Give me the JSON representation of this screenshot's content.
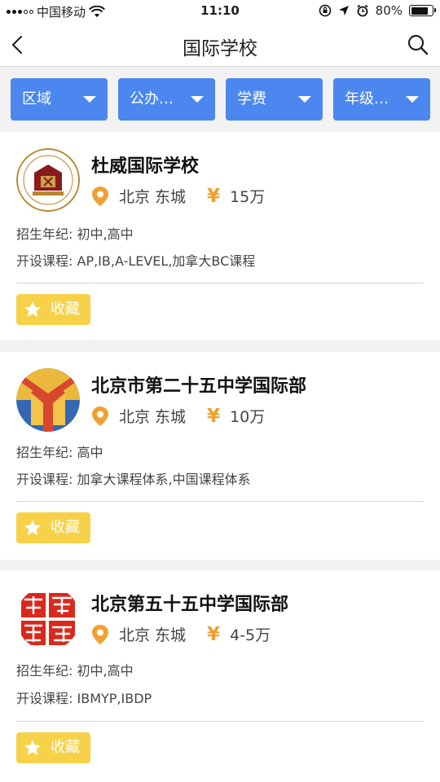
{
  "status_bar": {
    "carrier": "中国移动",
    "time": "11:10",
    "battery": "80%",
    "battery_level": 0.8
  },
  "nav": {
    "title": "国际学校",
    "back_icon": "chevron-left-icon",
    "search_icon": "search-icon"
  },
  "filters": [
    {
      "label": "区域"
    },
    {
      "label": "公办…"
    },
    {
      "label": "学费"
    },
    {
      "label": "年级…"
    }
  ],
  "schools": [
    {
      "name": "杜威国际学校",
      "location": "北京 东城",
      "fee": "15万",
      "grades_label": "招生年纪:",
      "grades": "初中,高中",
      "courses_label": "开设课程:",
      "courses": "AP,IB,A-LEVEL,加拿大BC课程",
      "fav_label": "收藏",
      "logo_text": "DEWEY INTERNATIONAL SCHOOL"
    },
    {
      "name": "北京市第二十五中学国际部",
      "location": "北京 东城",
      "fee": "10万",
      "grades_label": "招生年纪:",
      "grades": "高中",
      "courses_label": "开设课程:",
      "courses": "加拿大课程体系,中国课程体系",
      "fav_label": "收藏"
    },
    {
      "name": "北京第五十五中学国际部",
      "location": "北京 东城",
      "fee": "4-5万",
      "grades_label": "招生年纪:",
      "grades": "初中,高中",
      "courses_label": "开设课程:",
      "courses": "IBMYP,IBDP",
      "fav_label": "收藏"
    }
  ],
  "colors": {
    "filter_bg": "#4b87ee",
    "accent_orange": "#f0a030",
    "fav_yellow": "#f7d248"
  }
}
